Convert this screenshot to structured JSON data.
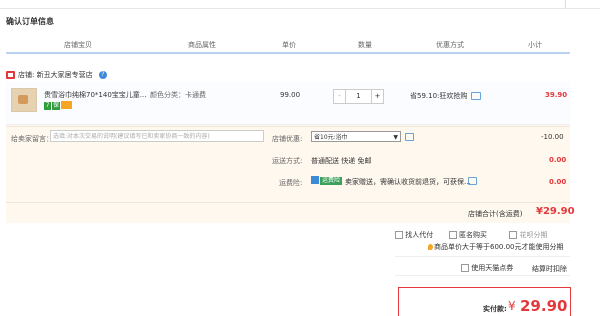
{
  "page": {
    "title": "确认订单信息"
  },
  "columns": [
    "店铺宝贝",
    "商品属性",
    "单价",
    "数量",
    "优惠方式",
    "小计"
  ],
  "shop": {
    "label": "店铺:",
    "name": "新丑大家居专营店"
  },
  "product": {
    "name": "贵雪浴巾纯棉70*140宝宝儿童...",
    "attribute": "颜色分类：卡通费",
    "price": "99.00",
    "quantity": "1",
    "minus": "-",
    "plus": "+",
    "promo": "省59.10:狂欢抢购",
    "subtotal": "39.90",
    "badges": [
      "7",
      "保"
    ]
  },
  "message": {
    "label": "给卖家留言：",
    "placeholder": "选填:对本次交易的说明(建议填写已和卖家协商一致的内容)"
  },
  "coupon": {
    "label": "店铺优惠:",
    "selected": "省10元:浴巾",
    "amount": "-10.00"
  },
  "shipping": {
    "label": "运送方式:",
    "value": "普通配送 快递 免邮",
    "amount": "0.00"
  },
  "insurance": {
    "label": "运费险:",
    "badge": "运费险",
    "text": "卖家赠送，需确认收货前退货，可获保...",
    "amount": "0.00"
  },
  "store_total": {
    "label": "店铺合计(含运费)",
    "value": "¥29.90"
  },
  "options": {
    "pay_for_other": "找人代付",
    "anonymous": "匿名购买",
    "installment": "花呗分期",
    "installment_note": "商品单价大于等于600.00元才能使用分期",
    "tmall_points": "使用天猫点券",
    "points_note": "结算时扣除"
  },
  "payment": {
    "label": "实付款:",
    "currency": "¥",
    "value": "29.90"
  },
  "colors": {
    "accent": "#e4393c",
    "header_border": "#b9d2ee",
    "order_bg": "#fff8ef"
  }
}
